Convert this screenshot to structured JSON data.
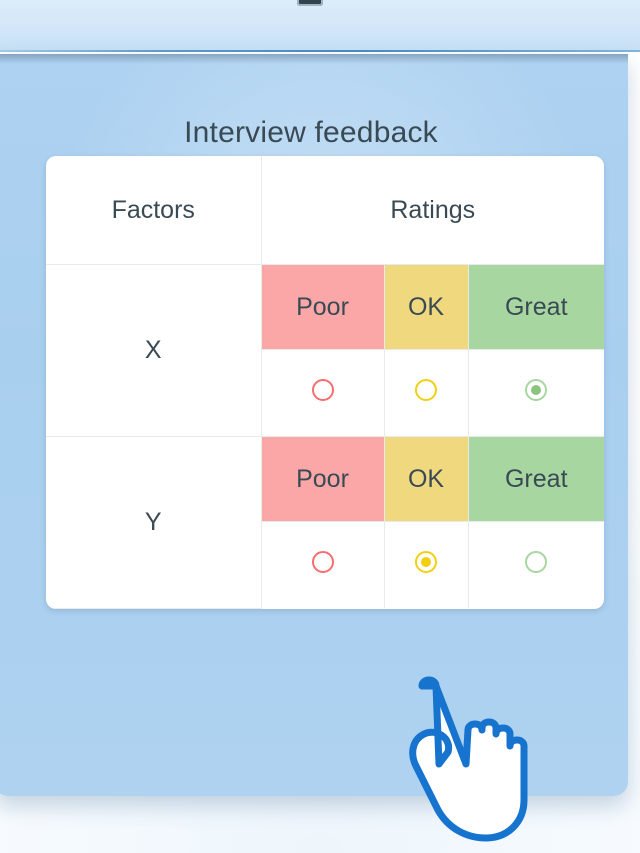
{
  "window": {
    "top_nub": "window-handle"
  },
  "panel": {
    "title": "Interview feedback",
    "background_color": "#aed2f0"
  },
  "table": {
    "headers": {
      "factors": "Factors",
      "ratings": "Ratings"
    },
    "rating_labels": [
      "Poor",
      "OK",
      "Great"
    ],
    "rating_colors": [
      "#fba7a7",
      "#f0d87e",
      "#a8d6a0"
    ],
    "radio_colors": [
      "#fb6d6d",
      "#f2cf10",
      "#8cc47f"
    ],
    "rows": [
      {
        "factor": "X",
        "labels": [
          "Poor",
          "OK",
          "Great"
        ],
        "selected_index": 2,
        "selected_label": "Great"
      },
      {
        "factor": "Y",
        "labels": [
          "Poor",
          "OK",
          "Great"
        ],
        "selected_index": 1,
        "selected_label": "OK"
      }
    ]
  },
  "cursor": {
    "icon": "pointing-hand-cursor",
    "color": "#1673ce",
    "target": "Y row OK radio"
  }
}
